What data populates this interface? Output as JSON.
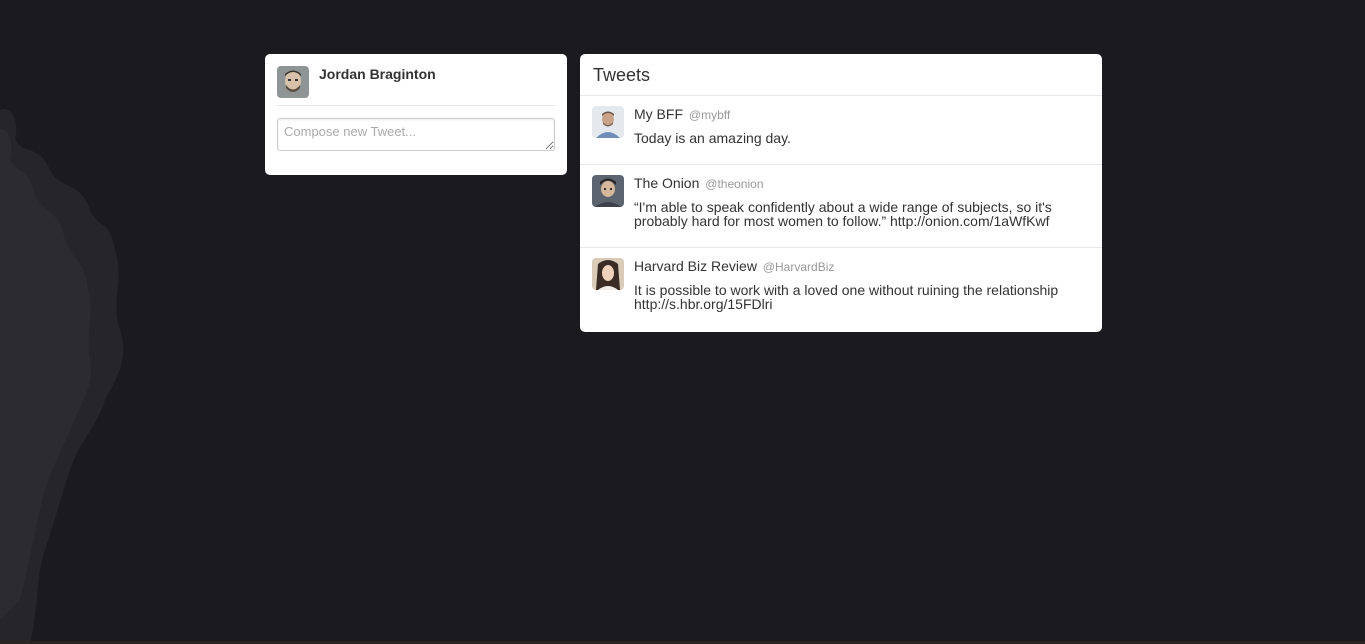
{
  "profile": {
    "name": "Jordan Braginton",
    "avatar_icon": "user-avatar-icon",
    "compose_placeholder": "Compose new Tweet..."
  },
  "tweets_panel": {
    "title": "Tweets",
    "items": [
      {
        "name": "My BFF",
        "handle": "@mybff",
        "text": "Today is an amazing day.",
        "avatar_icon": "user-avatar-icon"
      },
      {
        "name": "The Onion",
        "handle": "@theonion",
        "text": "“I'm able to speak confidently about a wide range of subjects, so it's probably hard for most women to follow.” http://onion.com/1aWfKwf",
        "avatar_icon": "user-avatar-icon"
      },
      {
        "name": "Harvard Biz Review",
        "handle": "@HarvardBiz",
        "text": "It is possible to work with a loved one without ruining the relationship http://s.hbr.org/15FDlri",
        "avatar_icon": "user-avatar-icon"
      }
    ]
  },
  "colors": {
    "background": "#1b1b1f",
    "card": "#ffffff",
    "text": "#333333",
    "muted": "#999999"
  }
}
